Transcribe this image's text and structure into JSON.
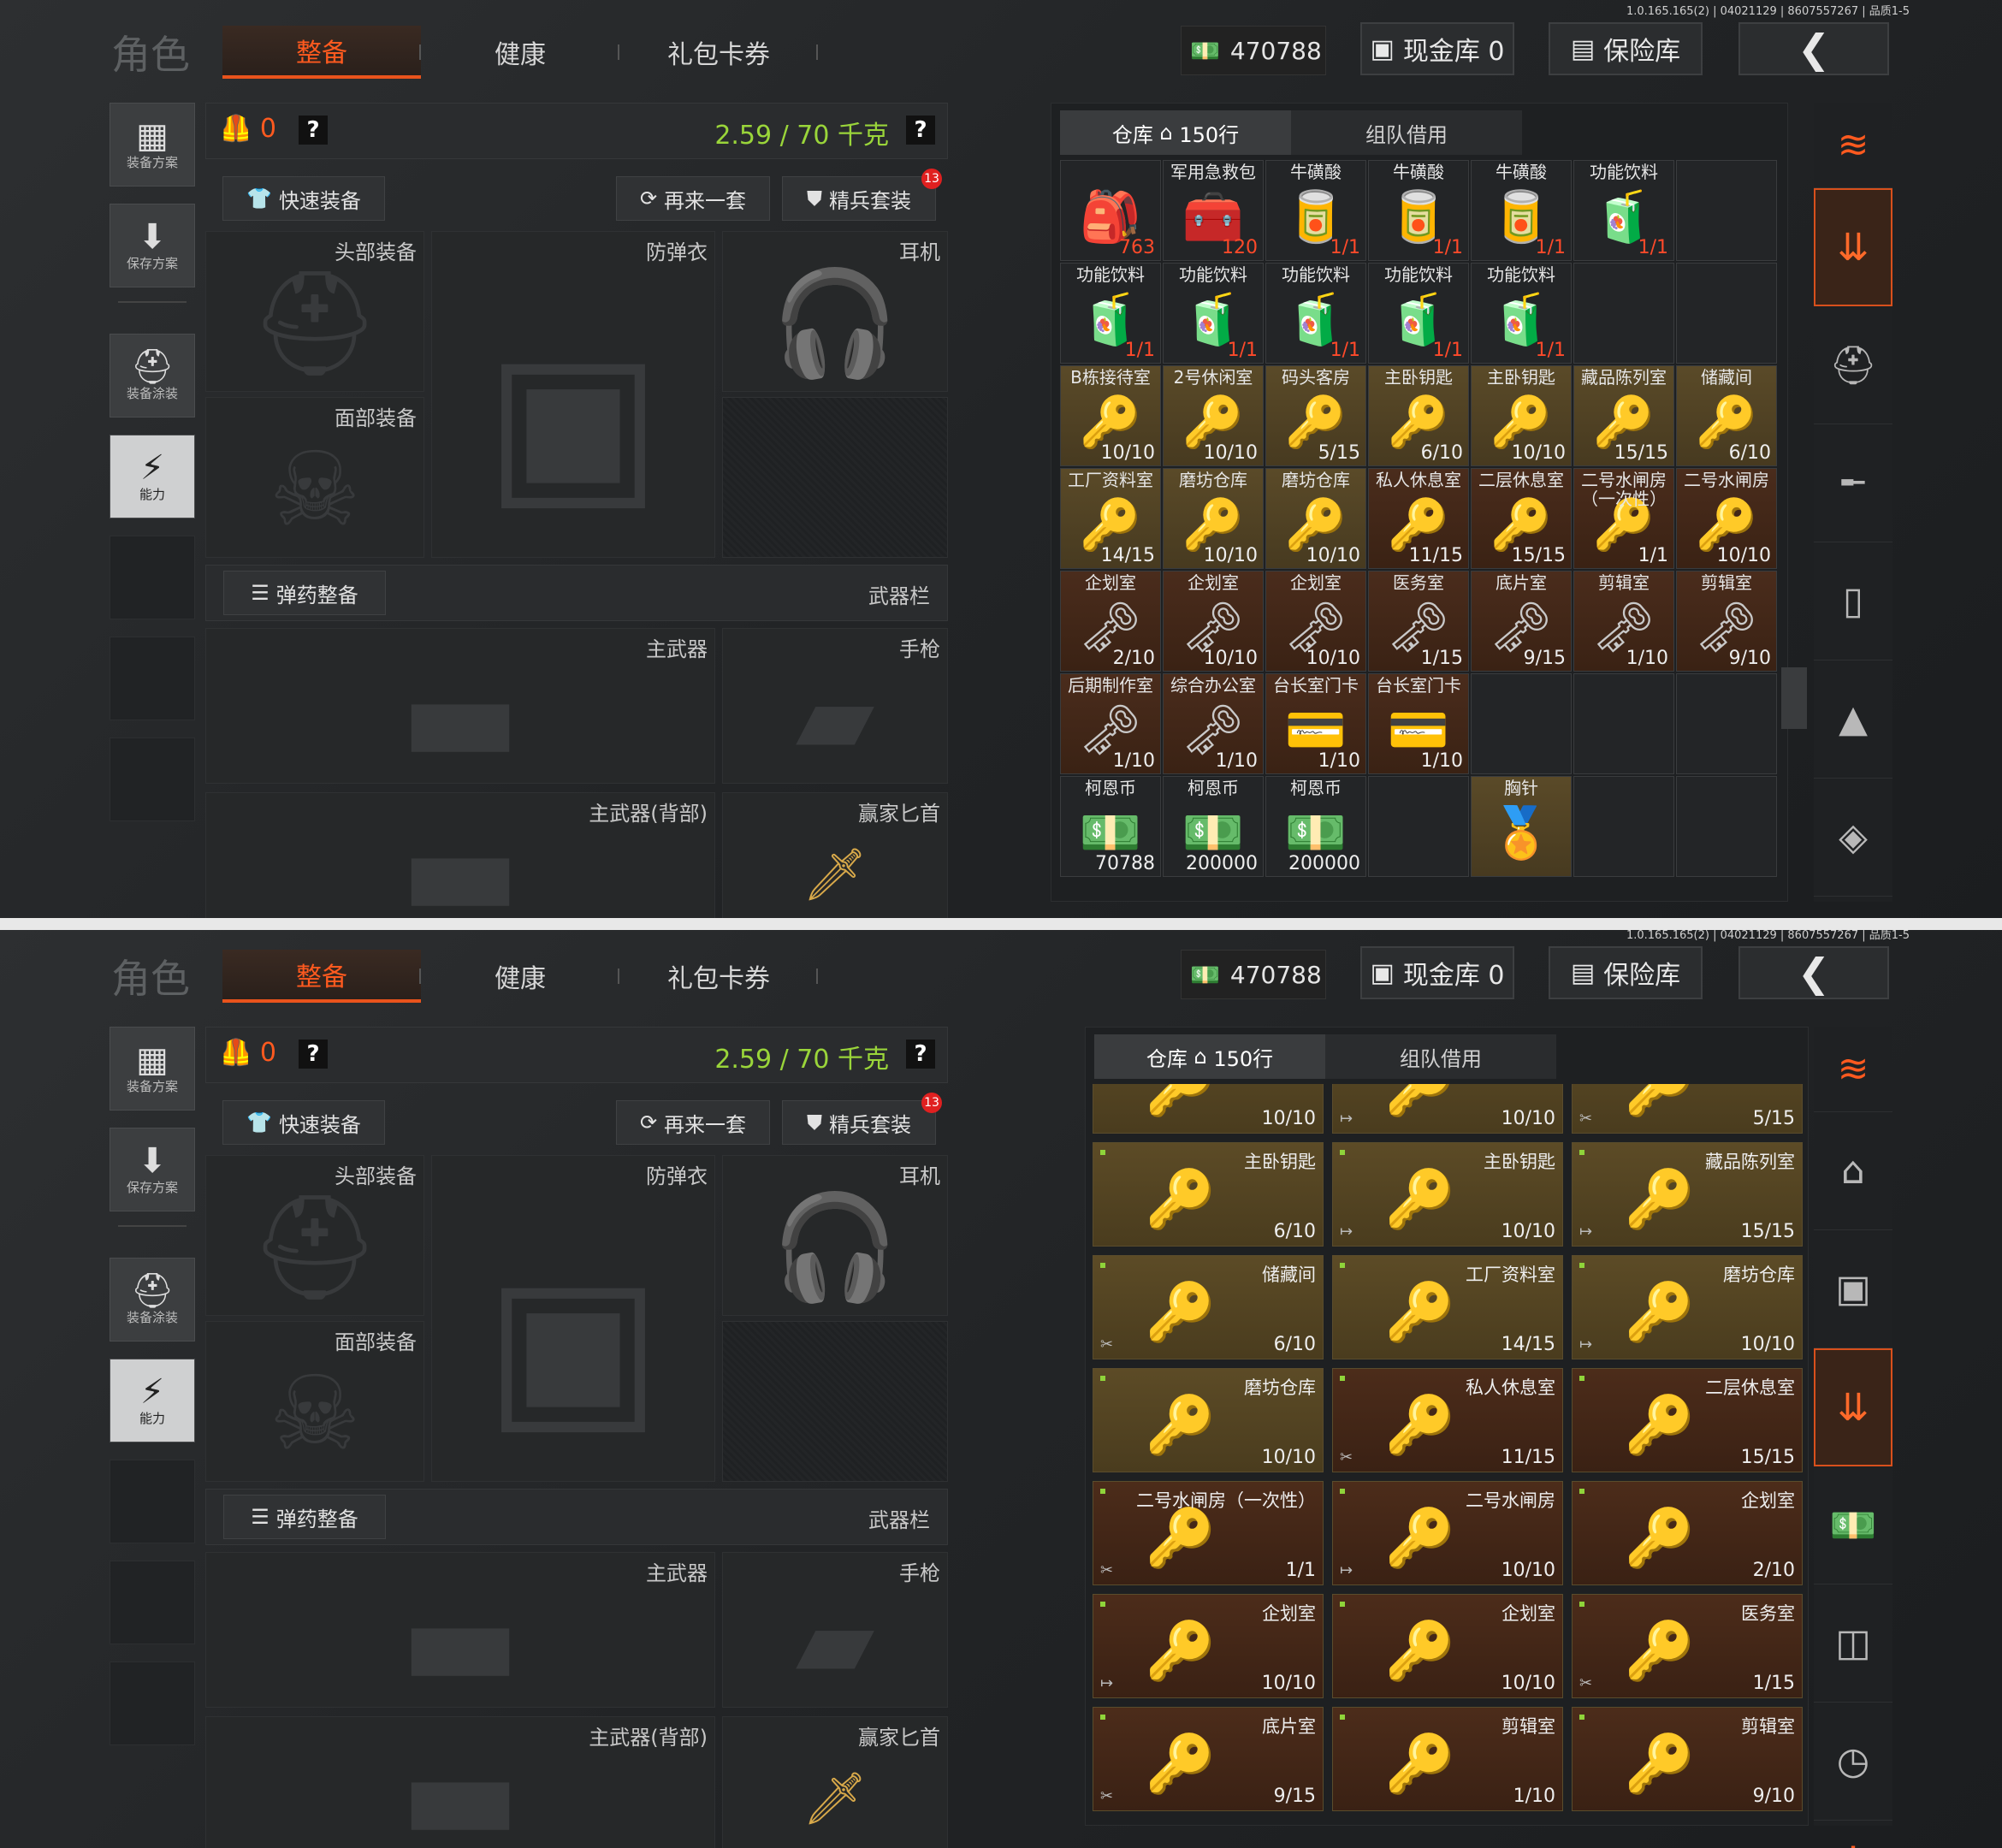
{
  "version": "1.0.165.165(2) | 04021129 | 8607557267 | 品质1-5",
  "title": "角色",
  "tabs": [
    "整备",
    "健康",
    "礼包卡券"
  ],
  "money": "470788",
  "cash_label": "现金库 0",
  "safe_label": "保险库",
  "left_buttons": [
    {
      "label": "装备方案",
      "icon": "vest-icon"
    },
    {
      "label": "保存方案",
      "icon": "download-icon"
    },
    {
      "label": "装备涂装",
      "icon": "helmet-paint-icon"
    },
    {
      "label": "能力",
      "icon": "ability-icon"
    }
  ],
  "equip": {
    "armor_count": "0",
    "weight": "2.59 / 70 千克",
    "quick_equip": "快速装备",
    "again": "再来一套",
    "elite": "精兵套装",
    "elite_badge": "13",
    "head": "头部装备",
    "vest": "防弹衣",
    "ear": "耳机",
    "face": "面部装备",
    "ammo": "弹药整备",
    "weapon_bar": "武器栏",
    "primary": "主武器",
    "pistol": "手枪",
    "primary_back": "主武器(背部)",
    "knife": "赢家匕首"
  },
  "warehouse": {
    "tab_storage": "仓库",
    "tab_rows": "150行",
    "tab_team": "组队借用"
  },
  "grid1": [
    {
      "name": "",
      "count": "763",
      "style": "dark red",
      "icon": "🎒"
    },
    {
      "name": "军用急救包",
      "count": "120",
      "style": "dark red",
      "icon": "🧰"
    },
    {
      "name": "牛磺酸",
      "count": "1/1",
      "style": "dark red",
      "icon": "🥫"
    },
    {
      "name": "牛磺酸",
      "count": "1/1",
      "style": "dark red",
      "icon": "🥫"
    },
    {
      "name": "牛磺酸",
      "count": "1/1",
      "style": "dark red",
      "icon": "🥫"
    },
    {
      "name": "功能饮料",
      "count": "1/1",
      "style": "dark red",
      "icon": "🧃"
    },
    {
      "name": "",
      "count": "",
      "style": "dark",
      "icon": ""
    },
    {
      "name": "功能饮料",
      "count": "1/1",
      "style": "dark red",
      "icon": "🧃"
    },
    {
      "name": "功能饮料",
      "count": "1/1",
      "style": "dark red",
      "icon": "🧃"
    },
    {
      "name": "功能饮料",
      "count": "1/1",
      "style": "dark red",
      "icon": "🧃"
    },
    {
      "name": "功能饮料",
      "count": "1/1",
      "style": "dark red",
      "icon": "🧃"
    },
    {
      "name": "功能饮料",
      "count": "1/1",
      "style": "dark red",
      "icon": "🧃"
    },
    {
      "name": "",
      "count": "",
      "style": "dark",
      "icon": ""
    },
    {
      "name": "",
      "count": "",
      "style": "dark",
      "icon": ""
    },
    {
      "name": "B栋接待室",
      "count": "10/10",
      "style": "gold",
      "icon": "🔑"
    },
    {
      "name": "2号休闲室",
      "count": "10/10",
      "style": "gold",
      "icon": "🔑"
    },
    {
      "name": "码头客房",
      "count": "5/15",
      "style": "gold",
      "icon": "🔑"
    },
    {
      "name": "主卧钥匙",
      "count": "6/10",
      "style": "gold",
      "icon": "🔑"
    },
    {
      "name": "主卧钥匙",
      "count": "10/10",
      "style": "gold",
      "icon": "🔑"
    },
    {
      "name": "藏品陈列室",
      "count": "15/15",
      "style": "gold",
      "icon": "🔑"
    },
    {
      "name": "储藏间",
      "count": "6/10",
      "style": "gold",
      "icon": "🔑"
    },
    {
      "name": "工厂资料室",
      "count": "14/15",
      "style": "gold",
      "icon": "🔑"
    },
    {
      "name": "磨坊仓库",
      "count": "10/10",
      "style": "gold",
      "icon": "🔑"
    },
    {
      "name": "磨坊仓库",
      "count": "10/10",
      "style": "gold",
      "icon": "🔑"
    },
    {
      "name": "私人休息室",
      "count": "11/15",
      "style": "brown",
      "icon": "🔑"
    },
    {
      "name": "二层休息室",
      "count": "15/15",
      "style": "brown",
      "icon": "🔑"
    },
    {
      "name": "二号水闸房（一次性）",
      "count": "1/1",
      "style": "brown",
      "icon": "🔑"
    },
    {
      "name": "二号水闸房",
      "count": "10/10",
      "style": "brown",
      "icon": "🔑"
    },
    {
      "name": "企划室",
      "count": "2/10",
      "style": "brown",
      "icon": "🗝"
    },
    {
      "name": "企划室",
      "count": "10/10",
      "style": "brown",
      "icon": "🗝"
    },
    {
      "name": "企划室",
      "count": "10/10",
      "style": "brown",
      "icon": "🗝"
    },
    {
      "name": "医务室",
      "count": "1/15",
      "style": "brown",
      "icon": "🗝"
    },
    {
      "name": "底片室",
      "count": "9/15",
      "style": "brown",
      "icon": "🗝"
    },
    {
      "name": "剪辑室",
      "count": "1/10",
      "style": "brown",
      "icon": "🗝"
    },
    {
      "name": "剪辑室",
      "count": "9/10",
      "style": "brown",
      "icon": "🗝"
    },
    {
      "name": "后期制作室",
      "count": "1/10",
      "style": "brown",
      "icon": "🗝"
    },
    {
      "name": "综合办公室",
      "count": "1/10",
      "style": "brown",
      "icon": "🗝"
    },
    {
      "name": "台长室门卡",
      "count": "1/10",
      "style": "brown",
      "icon": "💳"
    },
    {
      "name": "台长室门卡",
      "count": "1/10",
      "style": "brown",
      "icon": "💳"
    },
    {
      "name": "",
      "count": "",
      "style": "dark",
      "icon": ""
    },
    {
      "name": "",
      "count": "",
      "style": "dark",
      "icon": ""
    },
    {
      "name": "",
      "count": "",
      "style": "dark",
      "icon": ""
    },
    {
      "name": "柯恩币",
      "count": "70788",
      "style": "dark",
      "icon": "💵"
    },
    {
      "name": "柯恩币",
      "count": "200000",
      "style": "dark",
      "icon": "💵"
    },
    {
      "name": "柯恩币",
      "count": "200000",
      "style": "dark",
      "icon": "💵"
    },
    {
      "name": "",
      "count": "",
      "style": "dark",
      "icon": ""
    },
    {
      "name": "胸针",
      "count": "",
      "style": "gold",
      "icon": "🏅"
    },
    {
      "name": "",
      "count": "",
      "style": "dark",
      "icon": ""
    },
    {
      "name": "",
      "count": "",
      "style": "dark",
      "icon": ""
    }
  ],
  "grid2": [
    {
      "name": "",
      "count": "10/10",
      "style": "gold",
      "mark": ""
    },
    {
      "name": "",
      "count": "10/10",
      "style": "gold",
      "mark": "↦"
    },
    {
      "name": "",
      "count": "5/15",
      "style": "gold",
      "mark": "✂"
    },
    {
      "name": "主卧钥匙",
      "count": "6/10",
      "style": "gold",
      "mark": ""
    },
    {
      "name": "主卧钥匙",
      "count": "10/10",
      "style": "gold",
      "mark": "↦"
    },
    {
      "name": "藏品陈列室",
      "count": "15/15",
      "style": "gold",
      "mark": "↦"
    },
    {
      "name": "储藏间",
      "count": "6/10",
      "style": "gold",
      "mark": "✂"
    },
    {
      "name": "工厂资料室",
      "count": "14/15",
      "style": "gold",
      "mark": ""
    },
    {
      "name": "磨坊仓库",
      "count": "10/10",
      "style": "gold",
      "mark": "↦"
    },
    {
      "name": "磨坊仓库",
      "count": "10/10",
      "style": "gold",
      "mark": ""
    },
    {
      "name": "私人休息室",
      "count": "11/15",
      "style": "brown",
      "mark": "✂"
    },
    {
      "name": "二层休息室",
      "count": "15/15",
      "style": "brown",
      "mark": ""
    },
    {
      "name": "二号水闸房（一次性）",
      "count": "1/1",
      "style": "brown",
      "mark": "✂"
    },
    {
      "name": "二号水闸房",
      "count": "10/10",
      "style": "brown",
      "mark": "↦"
    },
    {
      "name": "企划室",
      "count": "2/10",
      "style": "brown",
      "mark": ""
    },
    {
      "name": "企划室",
      "count": "10/10",
      "style": "brown",
      "mark": "↦"
    },
    {
      "name": "企划室",
      "count": "10/10",
      "style": "brown",
      "mark": ""
    },
    {
      "name": "医务室",
      "count": "1/15",
      "style": "brown",
      "mark": "✂"
    },
    {
      "name": "底片室",
      "count": "9/15",
      "style": "brown",
      "mark": "✂"
    },
    {
      "name": "剪辑室",
      "count": "1/10",
      "style": "brown",
      "mark": ""
    },
    {
      "name": "剪辑室",
      "count": "9/10",
      "style": "brown",
      "mark": ""
    }
  ],
  "right_icons1": [
    "layers-refresh-icon",
    "layers-down-icon",
    "helmet-icon",
    "rifle-icon",
    "magazine-icon",
    "bullet-icon",
    "chest-icon"
  ],
  "right_icons2": [
    "layers-refresh-icon",
    "home-icon",
    "safe-icon",
    "layers-down-icon",
    "money-icon",
    "box-icon",
    "clock-icon"
  ],
  "accent": "#e9531c"
}
